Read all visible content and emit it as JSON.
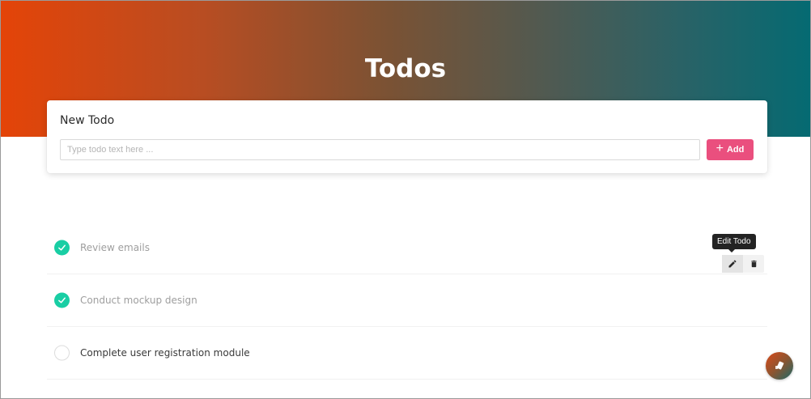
{
  "header": {
    "title": "Todos"
  },
  "new_todo": {
    "title": "New Todo",
    "input_value": "",
    "input_placeholder": "Type todo text here ...",
    "add_label": "Add"
  },
  "todos": [
    {
      "text": "Review emails",
      "done": true
    },
    {
      "text": "Conduct mockup design",
      "done": true
    },
    {
      "text": "Complete user registration module",
      "done": false
    }
  ],
  "tooltip": {
    "text": "Edit Todo"
  },
  "icons": {
    "check": "check-icon",
    "edit": "pencil-icon",
    "delete": "trash-icon",
    "add": "plus-icon",
    "fab": "app-icon"
  },
  "colors": {
    "accent": "#ea4f7e",
    "done": "#19cea4",
    "gradient_start": "#e44408",
    "gradient_end": "#056a72"
  }
}
